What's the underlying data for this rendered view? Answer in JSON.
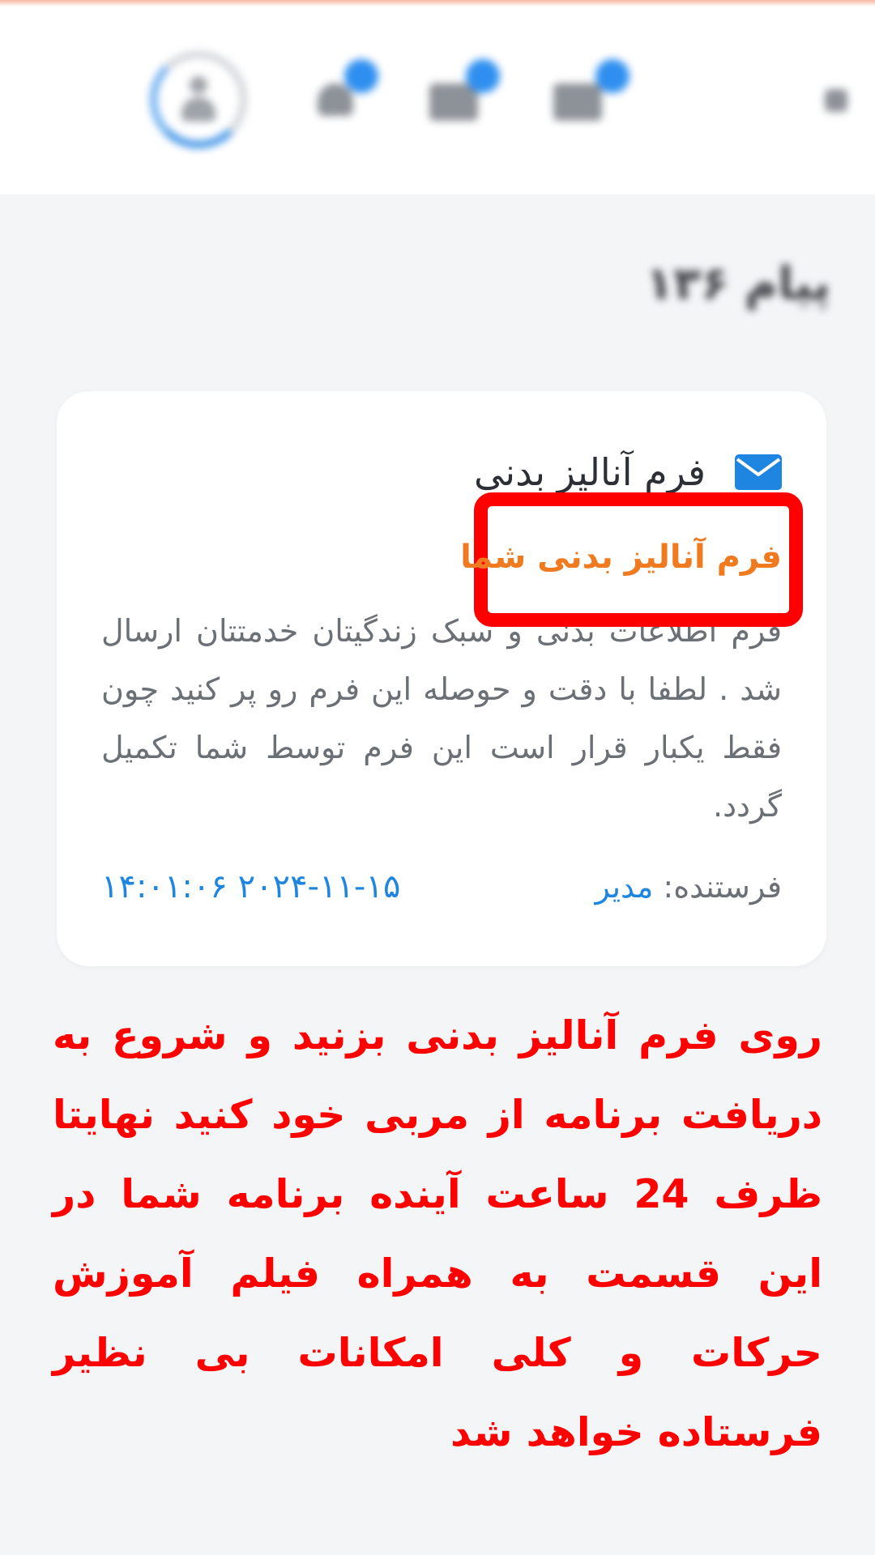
{
  "header": {
    "icons": [
      "notes-icon",
      "mail-icon",
      "bell-icon",
      "user-avatar",
      "menu-icon"
    ]
  },
  "page": {
    "title": "پیام ۱۳۶"
  },
  "message": {
    "title": "فرم آنالیز بدنی",
    "subject": "فرم آنالیز بدنی شما",
    "body": "فرم اطلاعات بدنی و سبک زندگیتان خدمتتان ارسال شد . لطفا با دقت و حوصله این فرم رو پر کنید چون فقط یکبار قرار است این فرم توسط شما تکمیل گردد.",
    "sender_label": "فرستنده:",
    "sender_name": "مدیر",
    "datetime": "۲۰۲۴-۱۱-۱۵ ۱۴:۰۱:۰۶"
  },
  "annotation": {
    "text": "روی فرم آنالیز بدنی بزنید و شروع به دریافت برنامه از مربی خود کنید نهایتا ظرف 24 ساعت آینده برنامه شما در این قسمت به همراه فیلم آموزش حرکات و کلی امکانات بی نظیر فرستاده خواهد شد"
  },
  "colors": {
    "accent_blue": "#1e86e0",
    "subject_orange": "#f07a20",
    "annotation_red": "#ff0000"
  }
}
